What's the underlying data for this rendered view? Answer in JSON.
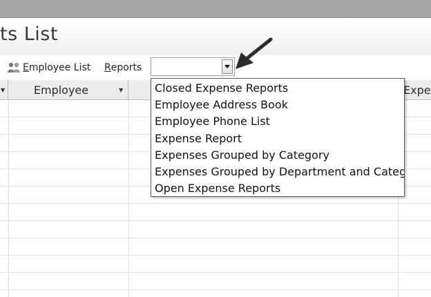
{
  "window": {
    "form_title": "ts List"
  },
  "toolbar": {
    "employee_list_underlined": "E",
    "employee_list_rest": "mployee List",
    "reports_underlined": "R",
    "reports_rest": "eports",
    "reports_combo_value": ""
  },
  "grid": {
    "columns": [
      {
        "label": ""
      },
      {
        "label": "Employee"
      },
      {
        "label": ""
      },
      {
        "label": "Expen"
      }
    ]
  },
  "reports_dropdown": {
    "items": [
      "Closed Expense Reports",
      "Employee Address Book",
      "Employee Phone List",
      "Expense Report",
      "Expenses Grouped by Category",
      "Expenses Grouped by Department and Catego",
      "Open Expense Reports"
    ]
  },
  "icons": {
    "employee_list": "people-icon",
    "combo_dropdown": "chevron-down-icon",
    "callout": "arrow-callout-icon"
  }
}
